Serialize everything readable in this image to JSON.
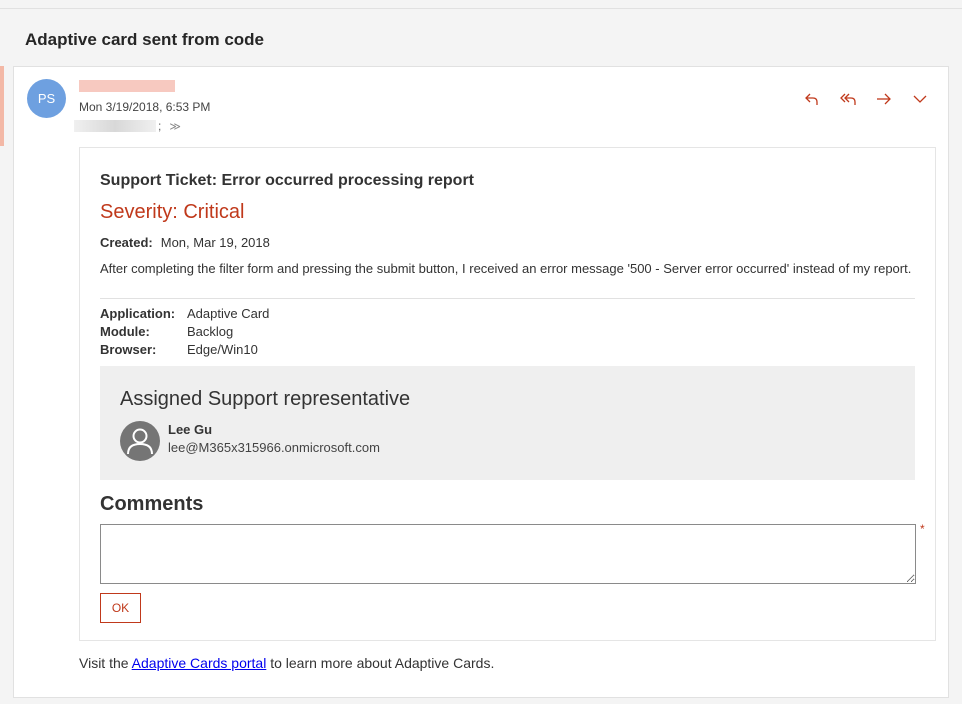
{
  "subject": "Adaptive card sent from code",
  "message": {
    "avatar_initials": "PS",
    "date": "Mon 3/19/2018, 6:53 PM",
    "to_separator": ";",
    "expand_glyph": "≫",
    "actions": [
      "reply-icon",
      "reply-all-icon",
      "forward-icon",
      "more-options-icon"
    ],
    "accent_color": "#c0391b"
  },
  "card": {
    "title": "Support Ticket: Error occurred processing report",
    "severity": "Severity: Critical",
    "created_label": "Created:",
    "created_value": "Mon, Mar 19, 2018",
    "description": "After completing the filter form and pressing the submit button, I received an error message '500 - Server error occurred' instead of my report.",
    "facts": [
      {
        "key": "Application:",
        "value": "Adaptive Card"
      },
      {
        "key": "Module:",
        "value": "Backlog"
      },
      {
        "key": "Browser:",
        "value": "Edge/Win10"
      }
    ],
    "rep": {
      "title": "Assigned Support representative",
      "name": "Lee Gu",
      "email": "lee@M365x315966.onmicrosoft.com"
    },
    "comments_label": "Comments",
    "comments_value": "",
    "required_mark": "*",
    "ok_label": "OK"
  },
  "footer": {
    "prefix": "Visit the ",
    "link": "Adaptive Cards portal",
    "suffix": " to learn more about Adaptive Cards."
  }
}
